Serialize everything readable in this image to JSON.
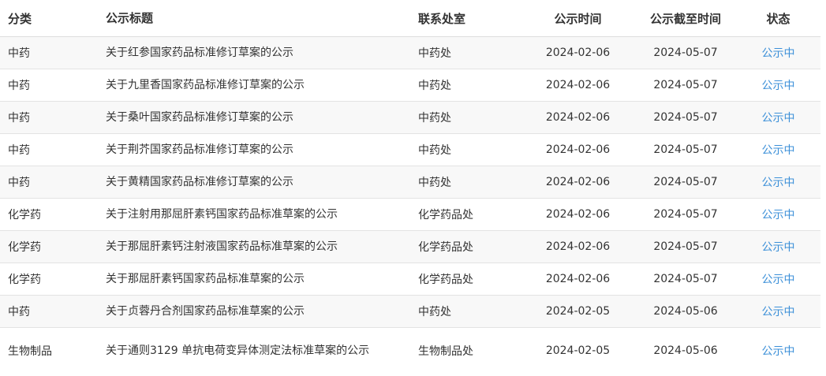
{
  "columns": {
    "category": "分类",
    "title": "公示标题",
    "office": "联系处室",
    "publish_date": "公示时间",
    "end_date": "公示截至时间",
    "status": "状态"
  },
  "rows": [
    {
      "category": "中药",
      "title": "关于红参国家药品标准修订草案的公示",
      "office": "中药处",
      "publish_date": "2024-02-06",
      "end_date": "2024-05-07",
      "status": "公示中"
    },
    {
      "category": "中药",
      "title": "关于九里香国家药品标准修订草案的公示",
      "office": "中药处",
      "publish_date": "2024-02-06",
      "end_date": "2024-05-07",
      "status": "公示中"
    },
    {
      "category": "中药",
      "title": "关于桑叶国家药品标准修订草案的公示",
      "office": "中药处",
      "publish_date": "2024-02-06",
      "end_date": "2024-05-07",
      "status": "公示中"
    },
    {
      "category": "中药",
      "title": "关于荆芥国家药品标准修订草案的公示",
      "office": "中药处",
      "publish_date": "2024-02-06",
      "end_date": "2024-05-07",
      "status": "公示中"
    },
    {
      "category": "中药",
      "title": "关于黄精国家药品标准修订草案的公示",
      "office": "中药处",
      "publish_date": "2024-02-06",
      "end_date": "2024-05-07",
      "status": "公示中"
    },
    {
      "category": "化学药",
      "title": "关于注射用那屈肝素钙国家药品标准草案的公示",
      "office": "化学药品处",
      "publish_date": "2024-02-06",
      "end_date": "2024-05-07",
      "status": "公示中"
    },
    {
      "category": "化学药",
      "title": "关于那屈肝素钙注射液国家药品标准草案的公示",
      "office": "化学药品处",
      "publish_date": "2024-02-06",
      "end_date": "2024-05-07",
      "status": "公示中"
    },
    {
      "category": "化学药",
      "title": "关于那屈肝素钙国家药品标准草案的公示",
      "office": "化学药品处",
      "publish_date": "2024-02-06",
      "end_date": "2024-05-07",
      "status": "公示中"
    },
    {
      "category": "中药",
      "title": "关于贞蓉丹合剂国家药品标准草案的公示",
      "office": "中药处",
      "publish_date": "2024-02-05",
      "end_date": "2024-05-06",
      "status": "公示中"
    },
    {
      "category": "生物制品",
      "title": "关于通则3129 单抗电荷变异体测定法标准草案的公示",
      "office": "生物制品处",
      "publish_date": "2024-02-05",
      "end_date": "2024-05-06",
      "status": "公示中"
    }
  ]
}
